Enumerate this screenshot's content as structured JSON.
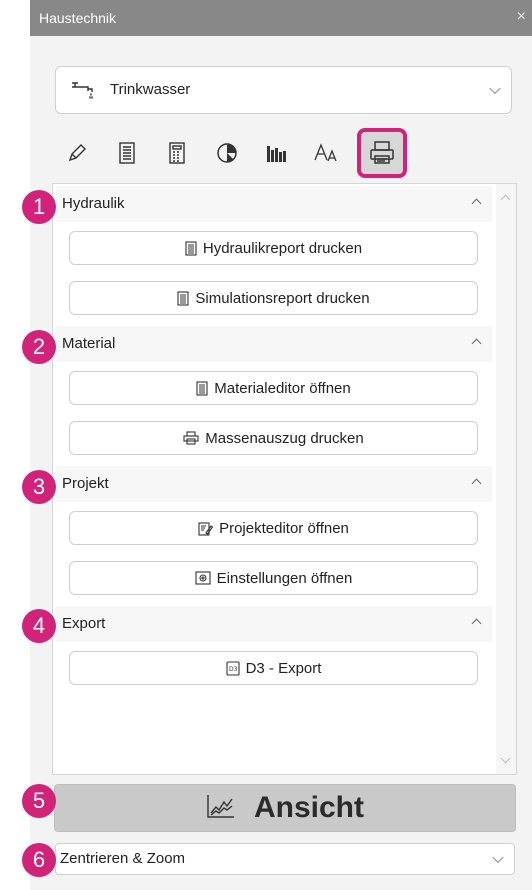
{
  "window": {
    "title": "Haustechnik",
    "close_glyph": "×"
  },
  "system_dropdown": {
    "value": "Trinkwasser",
    "icon": "water-tap-icon"
  },
  "toolbar": {
    "tools": [
      {
        "icon": "pencil-icon"
      },
      {
        "icon": "list-document-icon"
      },
      {
        "icon": "calculator-icon"
      },
      {
        "icon": "pie-chart-icon"
      },
      {
        "icon": "bar-chart-icon"
      },
      {
        "icon": "font-size-icon",
        "glyph": "Aₐ"
      },
      {
        "icon": "printer-icon",
        "active": true
      }
    ]
  },
  "sections": [
    {
      "title": "Hydraulik",
      "badge": "1",
      "buttons": [
        {
          "label": "Hydraulikreport drucken",
          "icon": "document-icon"
        },
        {
          "label": "Simulationsreport drucken",
          "icon": "document-icon"
        }
      ]
    },
    {
      "title": "Material",
      "badge": "2",
      "buttons": [
        {
          "label": "Materialeditor öffnen",
          "icon": "document-icon"
        },
        {
          "label": "Massenauszug drucken",
          "icon": "printer-icon"
        }
      ]
    },
    {
      "title": "Projekt",
      "badge": "3",
      "buttons": [
        {
          "label": "Projekteditor öffnen",
          "icon": "edit-document-icon"
        },
        {
          "label": "Einstellungen öffnen",
          "icon": "settings-icon"
        }
      ]
    },
    {
      "title": "Export",
      "badge": "4",
      "buttons": [
        {
          "label": "D3 - Export",
          "icon": "d3-file-icon"
        }
      ]
    }
  ],
  "view_button": {
    "label": "Ansicht",
    "badge": "5",
    "icon": "line-chart-icon"
  },
  "zoom_dropdown": {
    "value": "Zentrieren & Zoom",
    "badge": "6"
  },
  "colors": {
    "accent": "#d1237a",
    "titlebar": "#888888",
    "panel": "#f3f3f3"
  }
}
